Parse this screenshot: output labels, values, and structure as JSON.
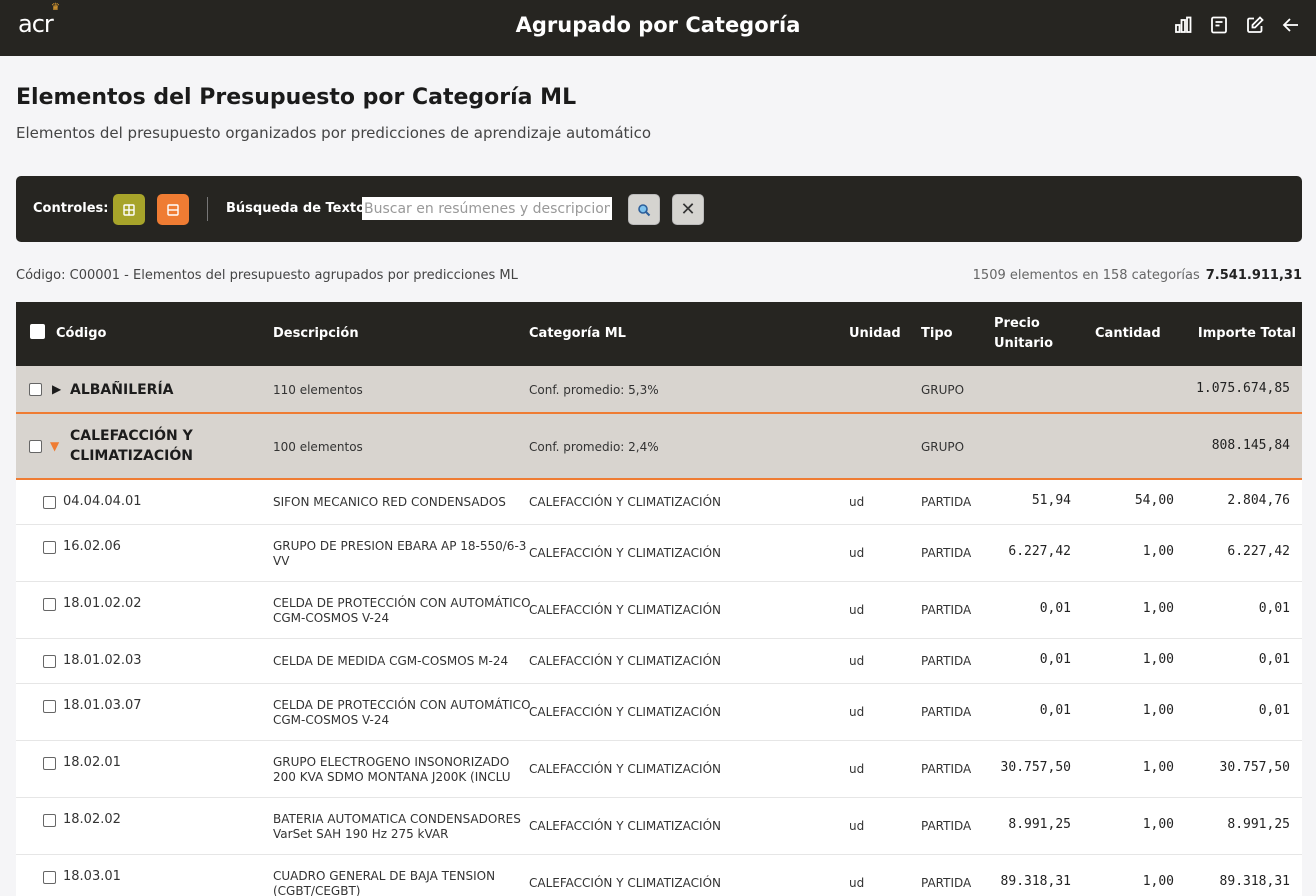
{
  "header": {
    "logo": "acr",
    "title": "Agrupado por Categoría",
    "icons": [
      "chart-icon",
      "report-icon",
      "edit-icon",
      "back-arrow-icon"
    ]
  },
  "page": {
    "title": "Elementos del Presupuesto por Categoría ML",
    "subtitle": "Elementos del presupuesto organizados por predicciones de aprendizaje automático"
  },
  "controls": {
    "label": "Controles:",
    "expand_icon": "expand-all-icon",
    "collapse_icon": "collapse-all-icon",
    "search_label": "Búsqueda de Texto:",
    "search_placeholder": "Buscar en resúmenes y descripciones",
    "search_value": "",
    "clear_symbol": "✕"
  },
  "info": {
    "left": "Código: C00001 - Elementos del presupuesto agrupados por predicciones ML",
    "right": "1509 elementos en 158 categorías",
    "total": "7.541.911,31"
  },
  "table": {
    "columns": {
      "codigo": "Código",
      "descripcion": "Descripción",
      "categoria": "Categoría ML",
      "unidad": "Unidad",
      "tipo": "Tipo",
      "precio_1": "Precio",
      "precio_2": "Unitario",
      "cantidad": "Cantidad",
      "importe": "Importe Total"
    },
    "groups": [
      {
        "name": "ALBAÑILERÍA",
        "count": "110 elementos",
        "conf": "Conf. promedio: 5,3%",
        "tipo": "GRUPO",
        "importe": "1.075.674,85",
        "expanded": false
      },
      {
        "name_1": "CALEFACCIÓN Y",
        "name_2": "CLIMATIZACIÓN",
        "count": "100 elementos",
        "conf": "Conf. promedio: 2,4%",
        "tipo": "GRUPO",
        "importe": "808.145,84",
        "expanded": true
      }
    ],
    "rows": [
      {
        "codigo": "04.04.04.01",
        "desc_1": "SIFON MECANICO RED CONDENSADOS",
        "desc_2": "",
        "categoria": "CALEFACCIÓN Y CLIMATIZACIÓN",
        "unidad": "ud",
        "tipo": "PARTIDA",
        "precio": "51,94",
        "cantidad": "54,00",
        "importe": "2.804,76"
      },
      {
        "codigo": "16.02.06",
        "desc_1": "GRUPO DE PRESION EBARA AP 18-550/6-3",
        "desc_2": "VV",
        "categoria": "CALEFACCIÓN Y CLIMATIZACIÓN",
        "unidad": "ud",
        "tipo": "PARTIDA",
        "precio": "6.227,42",
        "cantidad": "1,00",
        "importe": "6.227,42"
      },
      {
        "codigo": "18.01.02.02",
        "desc_1": "CELDA DE PROTECCIÓN CON AUTOMÁTICO",
        "desc_2": "CGM-COSMOS V-24",
        "categoria": "CALEFACCIÓN Y CLIMATIZACIÓN",
        "unidad": "ud",
        "tipo": "PARTIDA",
        "precio": "0,01",
        "cantidad": "1,00",
        "importe": "0,01"
      },
      {
        "codigo": "18.01.02.03",
        "desc_1": "CELDA DE MEDIDA CGM-COSMOS M-24",
        "desc_2": "",
        "categoria": "CALEFACCIÓN Y CLIMATIZACIÓN",
        "unidad": "ud",
        "tipo": "PARTIDA",
        "precio": "0,01",
        "cantidad": "1,00",
        "importe": "0,01"
      },
      {
        "codigo": "18.01.03.07",
        "desc_1": "CELDA DE PROTECCIÓN CON AUTOMÁTICO",
        "desc_2": "CGM-COSMOS V-24",
        "categoria": "CALEFACCIÓN Y CLIMATIZACIÓN",
        "unidad": "ud",
        "tipo": "PARTIDA",
        "precio": "0,01",
        "cantidad": "1,00",
        "importe": "0,01"
      },
      {
        "codigo": "18.02.01",
        "desc_1": "GRUPO ELECTROGENO INSONORIZADO",
        "desc_2": "200 KVA SDMO MONTANA J200K (INCLU",
        "categoria": "CALEFACCIÓN Y CLIMATIZACIÓN",
        "unidad": "ud",
        "tipo": "PARTIDA",
        "precio": "30.757,50",
        "cantidad": "1,00",
        "importe": "30.757,50"
      },
      {
        "codigo": "18.02.02",
        "desc_1": "BATERIA AUTOMATICA CONDENSADORES",
        "desc_2": "VarSet SAH 190 Hz 275 kVAR",
        "categoria": "CALEFACCIÓN Y CLIMATIZACIÓN",
        "unidad": "ud",
        "tipo": "PARTIDA",
        "precio": "8.991,25",
        "cantidad": "1,00",
        "importe": "8.991,25"
      },
      {
        "codigo": "18.03.01",
        "desc_1": "CUADRO GENERAL DE BAJA TENSION",
        "desc_2": "(CGBT/CEGBT)",
        "categoria": "CALEFACCIÓN Y CLIMATIZACIÓN",
        "unidad": "ud",
        "tipo": "PARTIDA",
        "precio": "89.318,31",
        "cantidad": "1,00",
        "importe": "89.318,31"
      }
    ]
  },
  "colors": {
    "dark": "#262521",
    "accent_orange": "#ef7c33",
    "accent_olive": "#a7a42a",
    "group_bg": "#d8d4cf"
  }
}
